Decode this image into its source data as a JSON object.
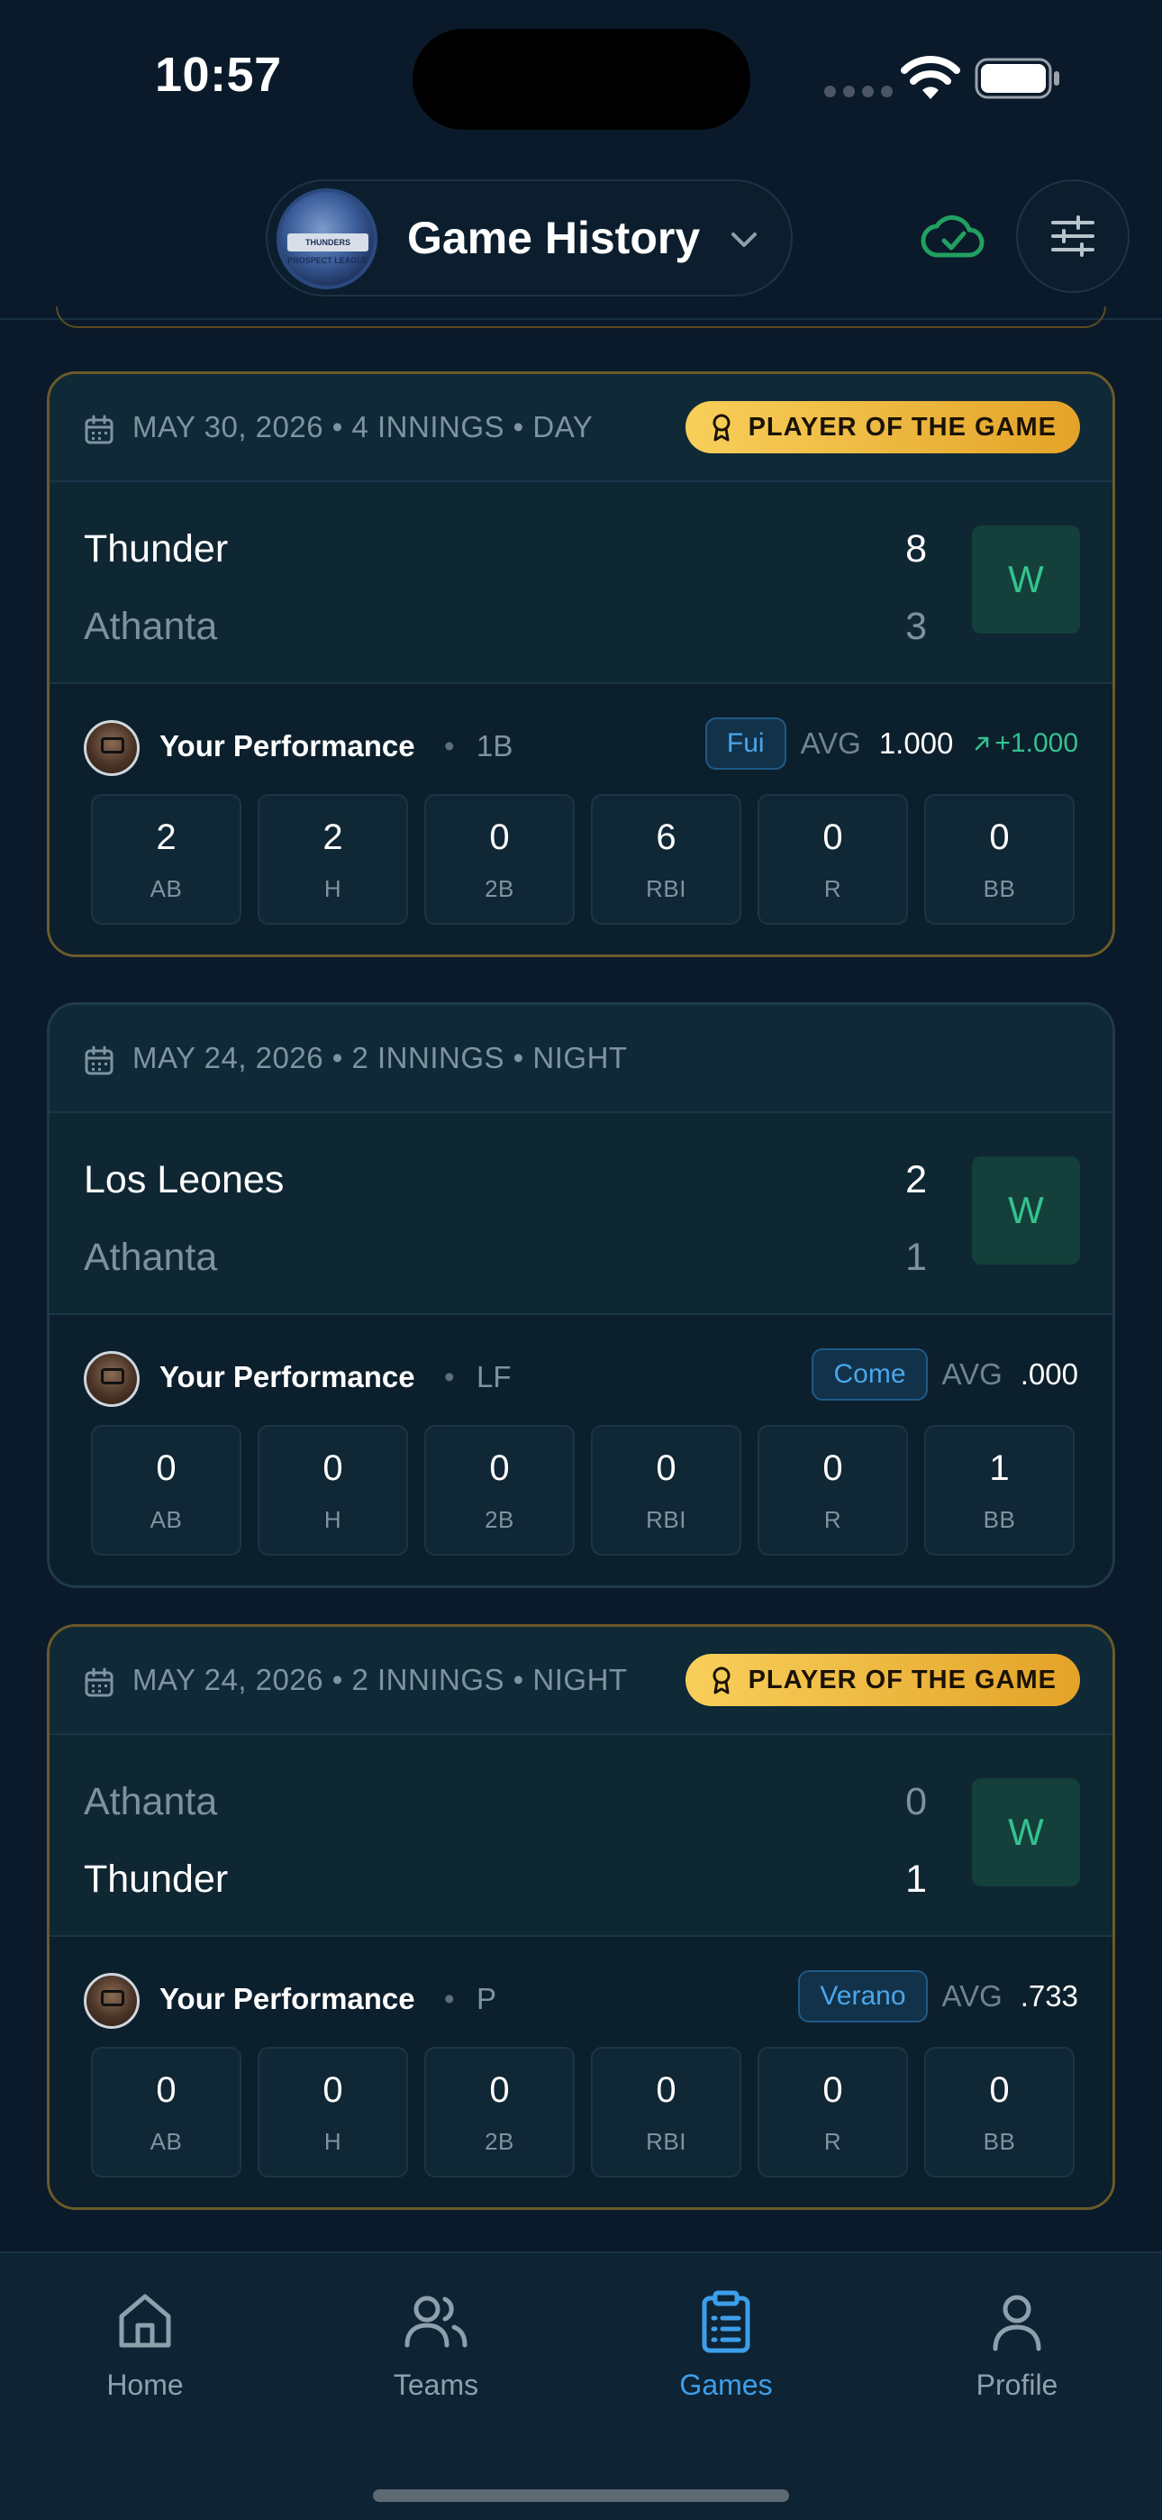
{
  "status_bar": {
    "time": "10:57"
  },
  "header": {
    "title": "Game History",
    "logo_text": "THUNDERS PROSPECT LEAGUE"
  },
  "games": [
    {
      "date_line": "MAY 30, 2026 • 4 INNINGS • DAY",
      "badge": "PLAYER OF THE GAME",
      "team1": {
        "name": "Thunder",
        "score": "8",
        "winner": true
      },
      "team2": {
        "name": "Athanta",
        "score": "3",
        "winner": false
      },
      "result": "W",
      "perf_label": "Your Performance",
      "position": "1B",
      "season": "Fui",
      "avg_label": "AVG",
      "avg": "1.000",
      "avg_delta": "+1.000",
      "stats": [
        {
          "value": "2",
          "label": "AB"
        },
        {
          "value": "2",
          "label": "H"
        },
        {
          "value": "0",
          "label": "2B"
        },
        {
          "value": "6",
          "label": "RBI"
        },
        {
          "value": "0",
          "label": "R"
        },
        {
          "value": "0",
          "label": "BB"
        }
      ]
    },
    {
      "date_line": "MAY 24, 2026 • 2 INNINGS • NIGHT",
      "badge": "",
      "team1": {
        "name": "Los Leones",
        "score": "2",
        "winner": true
      },
      "team2": {
        "name": "Athanta",
        "score": "1",
        "winner": false
      },
      "result": "W",
      "perf_label": "Your Performance",
      "position": "LF",
      "season": "Come",
      "avg_label": "AVG",
      "avg": ".000",
      "avg_delta": "",
      "stats": [
        {
          "value": "0",
          "label": "AB"
        },
        {
          "value": "0",
          "label": "H"
        },
        {
          "value": "0",
          "label": "2B"
        },
        {
          "value": "0",
          "label": "RBI"
        },
        {
          "value": "0",
          "label": "R"
        },
        {
          "value": "1",
          "label": "BB"
        }
      ]
    },
    {
      "date_line": "MAY 24, 2026 • 2 INNINGS • NIGHT",
      "badge": "PLAYER OF THE GAME",
      "team1": {
        "name": "Athanta",
        "score": "0",
        "winner": false
      },
      "team2": {
        "name": "Thunder",
        "score": "1",
        "winner": true
      },
      "result": "W",
      "perf_label": "Your Performance",
      "position": "P",
      "season": "Verano",
      "avg_label": "AVG",
      "avg": ".733",
      "avg_delta": "",
      "stats": [
        {
          "value": "0",
          "label": "AB"
        },
        {
          "value": "0",
          "label": "H"
        },
        {
          "value": "0",
          "label": "2B"
        },
        {
          "value": "0",
          "label": "RBI"
        },
        {
          "value": "0",
          "label": "R"
        },
        {
          "value": "0",
          "label": "BB"
        }
      ]
    }
  ],
  "nav": {
    "home": "Home",
    "teams": "Teams",
    "games": "Games",
    "profile": "Profile"
  },
  "colors": {
    "background": "#0a1a2a",
    "accent_blue": "#3d9fea",
    "win_green": "#35c28e",
    "potg_gold": "#f8cf5a"
  }
}
